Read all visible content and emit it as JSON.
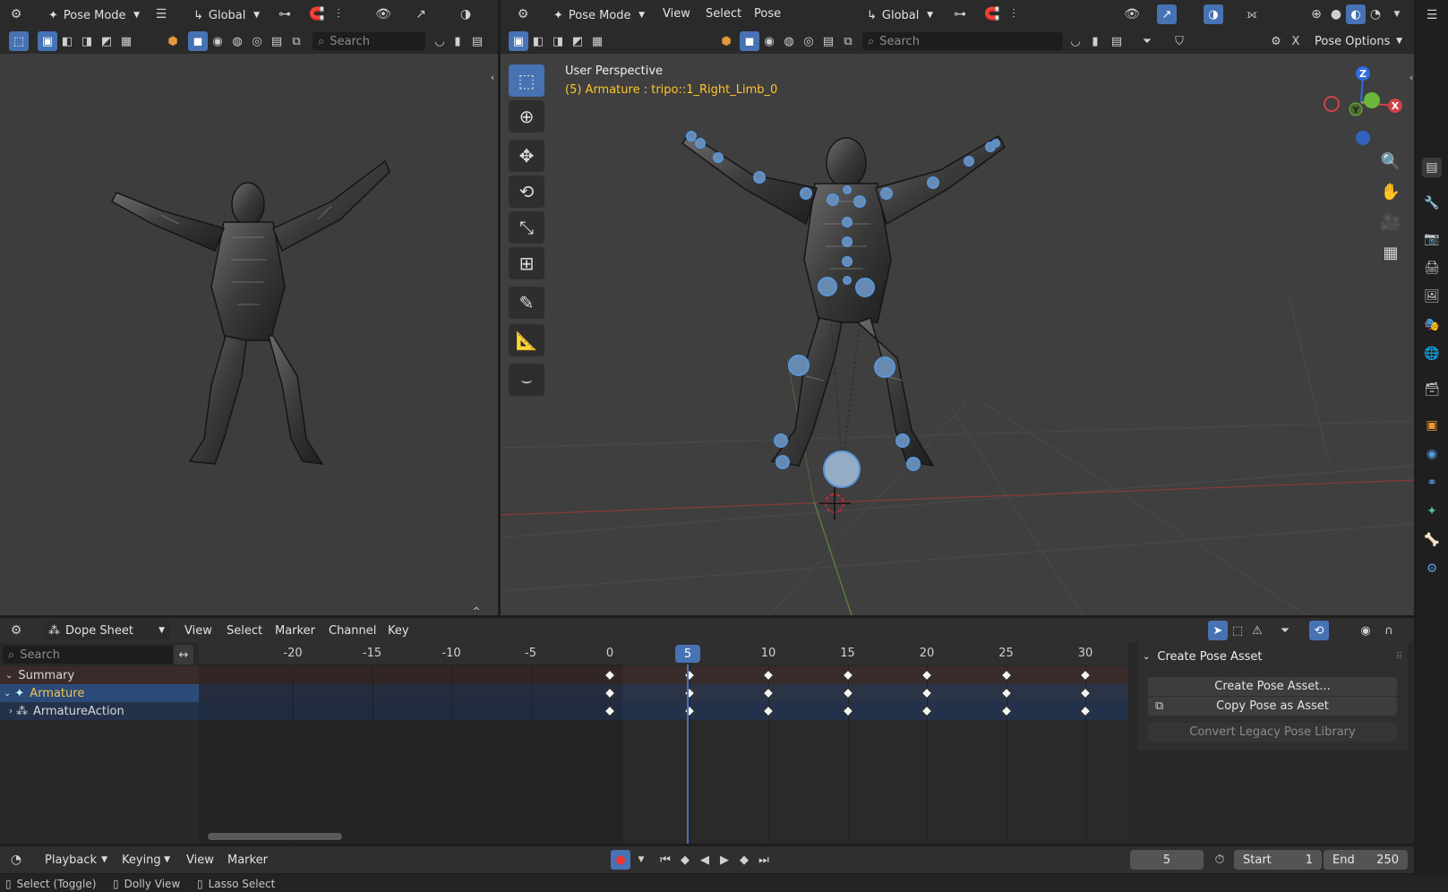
{
  "left_viewport_header": {
    "mode": "Pose Mode",
    "orientation": "Global",
    "search_placeholder": "Search"
  },
  "main_viewport_header": {
    "mode": "Pose Mode",
    "menus": [
      "View",
      "Select",
      "Pose"
    ],
    "orientation": "Global",
    "search_placeholder": "Search",
    "pose_options": "Pose Options"
  },
  "viewport_overlay": {
    "view_name": "User Perspective",
    "active_info": "(5) Armature : tripo::1_Right_Limb_0"
  },
  "gizmo_axes": {
    "z": "Z",
    "y": "Y",
    "x": "X"
  },
  "dope_sheet": {
    "editor": "Dope Sheet",
    "menus": [
      "View",
      "Select",
      "Marker",
      "Channel",
      "Key"
    ],
    "search_placeholder": "Search",
    "channels": [
      {
        "label": "Summary",
        "expanded": true
      },
      {
        "label": "Armature",
        "expanded": true
      },
      {
        "label": "ArmatureAction",
        "expanded": false
      }
    ],
    "ruler_ticks": [
      "-20",
      "-15",
      "-10",
      "-5",
      "0",
      "5",
      "10",
      "15",
      "20",
      "25",
      "30"
    ],
    "current_frame": "5",
    "keyframes": [
      0,
      5,
      10,
      15,
      20,
      25,
      30
    ]
  },
  "pose_library_panel": {
    "title": "Create Pose Asset",
    "buttons": [
      "Create Pose Asset...",
      "Copy Pose as Asset",
      "Convert Legacy Pose Library"
    ]
  },
  "timeline": {
    "menus": [
      "Playback",
      "Keying",
      "View",
      "Marker"
    ],
    "current_frame": "5",
    "start_label": "Start",
    "start_value": "1",
    "end_label": "End",
    "end_value": "250"
  },
  "status_bar": {
    "items": [
      "Select (Toggle)",
      "Dolly View",
      "Lasso Select"
    ]
  },
  "colors": {
    "accent": "#4772b3",
    "bone": "#5c9be0",
    "header": "#303030",
    "viewport_bg": "#3d3d3d"
  }
}
